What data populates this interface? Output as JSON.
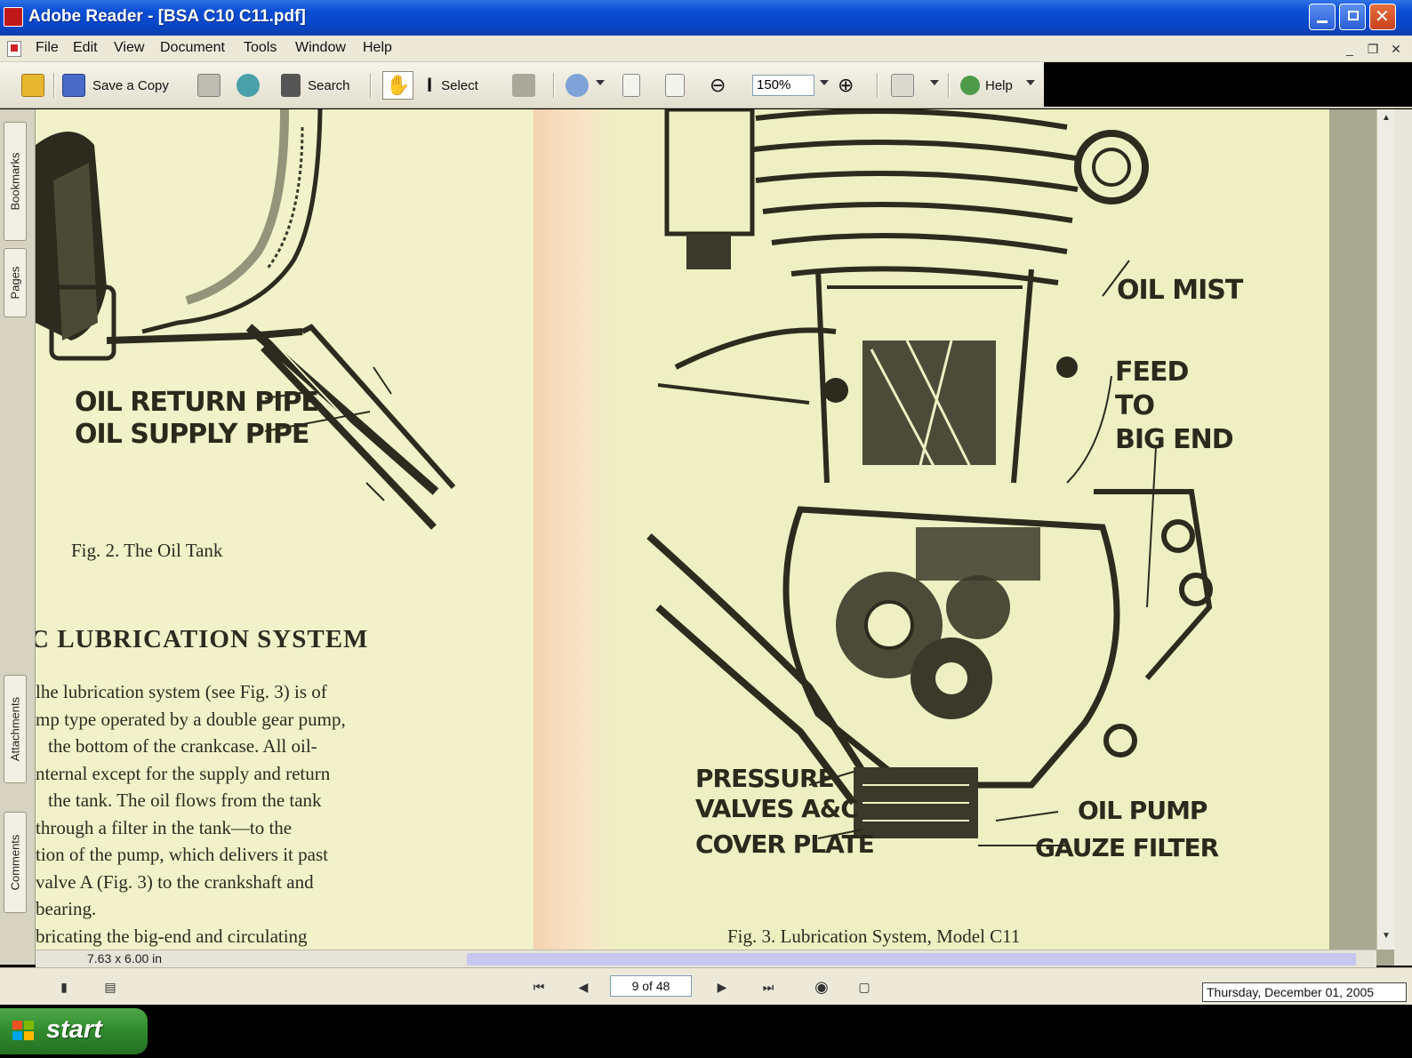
{
  "window": {
    "title": "Adobe Reader - [BSA C10 C11.pdf]"
  },
  "menu": {
    "items": [
      "File",
      "Edit",
      "View",
      "Document",
      "Tools",
      "Window",
      "Help"
    ]
  },
  "toolbar": {
    "save_copy": "Save a Copy",
    "search": "Search",
    "select": "Select",
    "zoom": "150%",
    "help": "Help"
  },
  "side_tabs": {
    "bookmarks": "Bookmarks",
    "pages": "Pages",
    "attachments": "Attachments",
    "comments": "Comments"
  },
  "page_left": {
    "label_return": "OIL RETURN PIPE",
    "label_supply": "OIL SUPPLY PIPE",
    "fig_caption": "Fig. 2.   The Oil Tank",
    "heading": "C LUBRICATION  SYSTEM",
    "body_lines": [
      "lhe lubrication system (see Fig. 3) is of",
      "mp type operated by a double gear pump,",
      "the bottom of the crankcase.  All oil-",
      "nternal except for the supply and return",
      "the tank.  The oil flows from the tank",
      "through a filter in the tank—to the",
      "tion of the pump, which delivers it past",
      "valve A (Fig. 3) to the crankshaft and",
      "bearing.",
      "bricating the big-end and circulating"
    ]
  },
  "page_right": {
    "label_oil_mist": "OIL MIST",
    "label_feed": "FEED",
    "label_to": "TO",
    "label_big_end": "BIG END",
    "label_pressure": "PRESSURE",
    "label_valves": "VALVES A&C",
    "label_cover": "COVER PLATE",
    "label_oil_pump": "OIL PUMP",
    "label_gauze": "GAUZE FILTER",
    "fig_caption": "Fig. 3.   Lubrication System, Model C11"
  },
  "status": {
    "page_size": "7.63 x 6.00 in",
    "page_counter": "9 of 48",
    "date": "Thursday, December 01, 2005"
  },
  "taskbar": {
    "start_label": "start"
  }
}
